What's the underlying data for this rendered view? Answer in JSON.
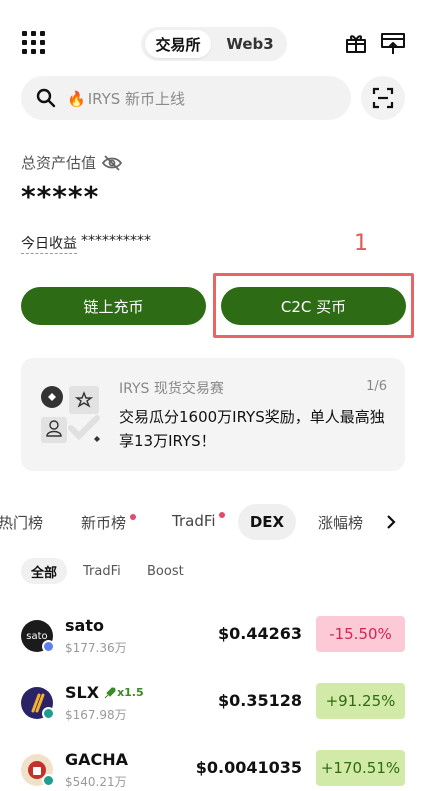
{
  "header": {
    "tabs": [
      {
        "label": "交易所",
        "active": true
      },
      {
        "label": "Web3",
        "active": false
      }
    ]
  },
  "search": {
    "placeholder": "IRYS 新币上线"
  },
  "assets": {
    "label": "总资产估值",
    "value": "*****",
    "today_label": "今日收益",
    "today_value": "**********"
  },
  "annotation": {
    "number": "1"
  },
  "actions": {
    "deposit": "链上充币",
    "buy": "C2C 买币"
  },
  "promo": {
    "title": "IRYS 现货交易赛",
    "page": "1/6",
    "body": "交易瓜分1600万IRYS奖励，单人最高独享13万IRYS！"
  },
  "tabs": {
    "items": [
      "热门榜",
      "新币榜",
      "TradFi",
      "DEX",
      "涨幅榜"
    ],
    "active": "DEX"
  },
  "subtabs": {
    "items": [
      "全部",
      "TradFi",
      "Boost"
    ],
    "active": "全部"
  },
  "tokens": [
    {
      "name": "sato",
      "cap": "$177.36万",
      "price": "$0.44263",
      "change": "-15.50%",
      "direction": "down",
      "icon_text": "sato"
    },
    {
      "name": "SLX",
      "boost": "x1.5",
      "cap": "$167.98万",
      "price": "$0.35128",
      "change": "+91.25%",
      "direction": "up"
    },
    {
      "name": "GACHA",
      "cap": "$540.21万",
      "price": "$0.0041035",
      "change": "+170.51%",
      "direction": "up"
    }
  ],
  "colors": {
    "primary_green": "#2d6b14",
    "negative_bg": "#fcc9d7",
    "negative_text": "#cc2850",
    "positive_bg": "#d2eaa7",
    "positive_text": "#2f6b12",
    "annotation_red": "#e96565"
  }
}
